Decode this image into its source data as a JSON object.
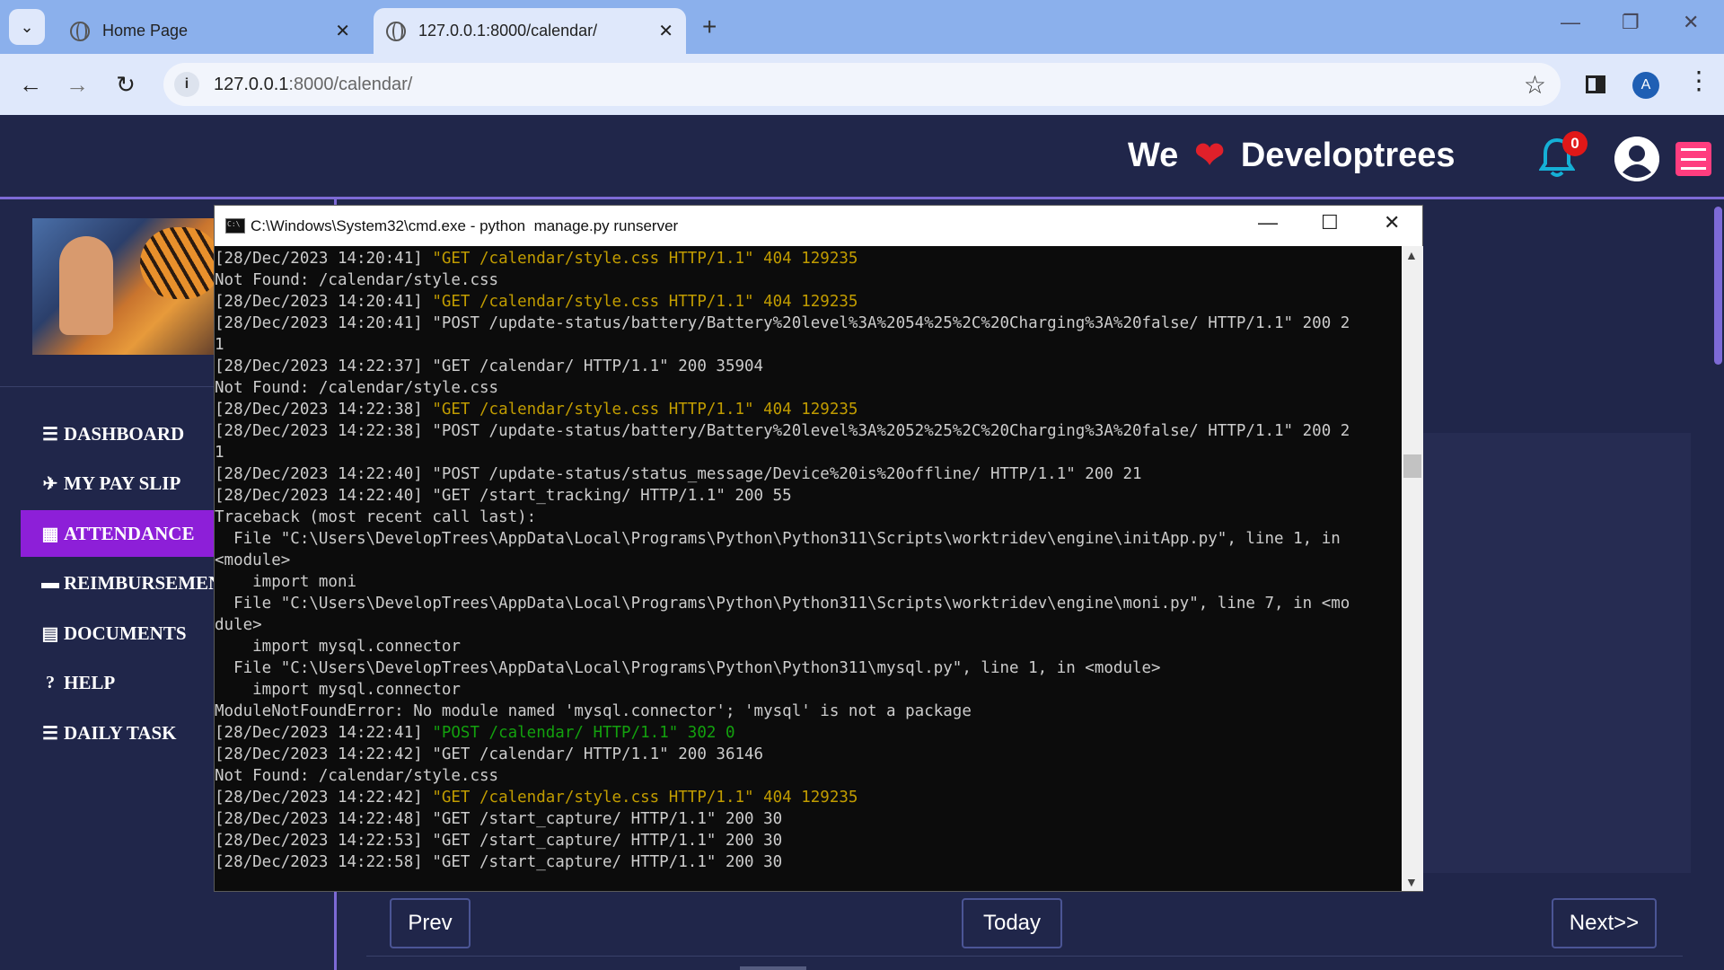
{
  "browser": {
    "tabs": [
      {
        "title": "Home Page",
        "active": false
      },
      {
        "title": "127.0.0.1:8000/calendar/",
        "active": true
      }
    ],
    "url_host": "127.0.0.1",
    "url_rest": ":8000/calendar/",
    "profile_initial": "A"
  },
  "site": {
    "brand_left": "We",
    "brand_heart": "❤",
    "brand_right": "Developtrees",
    "notification_count": "0",
    "nav": [
      {
        "icon": "☰",
        "label": "DASHBOARD",
        "active": false
      },
      {
        "icon": "✈",
        "label": "MY PAY SLIP",
        "active": false
      },
      {
        "icon": "▦",
        "label": "ATTENDANCE",
        "active": true
      },
      {
        "icon": "▬",
        "label": "REIMBURSEMENT",
        "active": false
      },
      {
        "icon": "▤",
        "label": "DOCUMENTS",
        "active": false
      },
      {
        "icon": "?",
        "label": "HELP",
        "active": false
      },
      {
        "icon": "☰",
        "label": "DAILY TASK",
        "active": false
      }
    ],
    "calendar_buttons": {
      "prev": "Prev",
      "today": "Today",
      "next": "Next>>"
    }
  },
  "cmd": {
    "title": "C:\\Windows\\System32\\cmd.exe - python  manage.py runserver",
    "lines": [
      {
        "p": "[28/Dec/2023 14:20:41] ",
        "h": "\"GET /calendar/style.css HTTP/1.1\" 404 129235",
        "c": "y"
      },
      {
        "p": "Not Found: /calendar/style.css",
        "h": "",
        "c": ""
      },
      {
        "p": "[28/Dec/2023 14:20:41] ",
        "h": "\"GET /calendar/style.css HTTP/1.1\" 404 129235",
        "c": "y"
      },
      {
        "p": "[28/Dec/2023 14:20:41] \"POST /update-status/battery/Battery%20level%3A%2054%25%2C%20Charging%3A%20false/ HTTP/1.1\" 200 2",
        "h": "",
        "c": ""
      },
      {
        "p": "1",
        "h": "",
        "c": ""
      },
      {
        "p": "[28/Dec/2023 14:22:37] \"GET /calendar/ HTTP/1.1\" 200 35904",
        "h": "",
        "c": ""
      },
      {
        "p": "Not Found: /calendar/style.css",
        "h": "",
        "c": ""
      },
      {
        "p": "[28/Dec/2023 14:22:38] ",
        "h": "\"GET /calendar/style.css HTTP/1.1\" 404 129235",
        "c": "y"
      },
      {
        "p": "[28/Dec/2023 14:22:38] \"POST /update-status/battery/Battery%20level%3A%2052%25%2C%20Charging%3A%20false/ HTTP/1.1\" 200 2",
        "h": "",
        "c": ""
      },
      {
        "p": "1",
        "h": "",
        "c": ""
      },
      {
        "p": "[28/Dec/2023 14:22:40] \"POST /update-status/status_message/Device%20is%20offline/ HTTP/1.1\" 200 21",
        "h": "",
        "c": ""
      },
      {
        "p": "[28/Dec/2023 14:22:40] \"GET /start_tracking/ HTTP/1.1\" 200 55",
        "h": "",
        "c": ""
      },
      {
        "p": "Traceback (most recent call last):",
        "h": "",
        "c": ""
      },
      {
        "p": "  File \"C:\\Users\\DevelopTrees\\AppData\\Local\\Programs\\Python\\Python311\\Scripts\\worktridev\\engine\\initApp.py\", line 1, in",
        "h": "",
        "c": ""
      },
      {
        "p": "<module>",
        "h": "",
        "c": ""
      },
      {
        "p": "    import moni",
        "h": "",
        "c": ""
      },
      {
        "p": "  File \"C:\\Users\\DevelopTrees\\AppData\\Local\\Programs\\Python\\Python311\\Scripts\\worktridev\\engine\\moni.py\", line 7, in <mo",
        "h": "",
        "c": ""
      },
      {
        "p": "dule>",
        "h": "",
        "c": ""
      },
      {
        "p": "    import mysql.connector",
        "h": "",
        "c": ""
      },
      {
        "p": "  File \"C:\\Users\\DevelopTrees\\AppData\\Local\\Programs\\Python\\Python311\\mysql.py\", line 1, in <module>",
        "h": "",
        "c": ""
      },
      {
        "p": "    import mysql.connector",
        "h": "",
        "c": ""
      },
      {
        "p": "ModuleNotFoundError: No module named 'mysql.connector'; 'mysql' is not a package",
        "h": "",
        "c": ""
      },
      {
        "p": "[28/Dec/2023 14:22:41] ",
        "h": "\"POST /calendar/ HTTP/1.1\" 302 0",
        "c": "g"
      },
      {
        "p": "[28/Dec/2023 14:22:42] \"GET /calendar/ HTTP/1.1\" 200 36146",
        "h": "",
        "c": ""
      },
      {
        "p": "Not Found: /calendar/style.css",
        "h": "",
        "c": ""
      },
      {
        "p": "[28/Dec/2023 14:22:42] ",
        "h": "\"GET /calendar/style.css HTTP/1.1\" 404 129235",
        "c": "y"
      },
      {
        "p": "[28/Dec/2023 14:22:48] \"GET /start_capture/ HTTP/1.1\" 200 30",
        "h": "",
        "c": ""
      },
      {
        "p": "[28/Dec/2023 14:22:53] \"GET /start_capture/ HTTP/1.1\" 200 30",
        "h": "",
        "c": ""
      },
      {
        "p": "[28/Dec/2023 14:22:58] \"GET /start_capture/ HTTP/1.1\" 200 30",
        "h": "",
        "c": ""
      }
    ]
  },
  "colors": {
    "page_bg": "#20264a",
    "accent_purple": "#8d1fd8",
    "menu_pink": "#ff3d7f",
    "terminal_yellow": "#c19c00",
    "terminal_green": "#13a10e"
  }
}
